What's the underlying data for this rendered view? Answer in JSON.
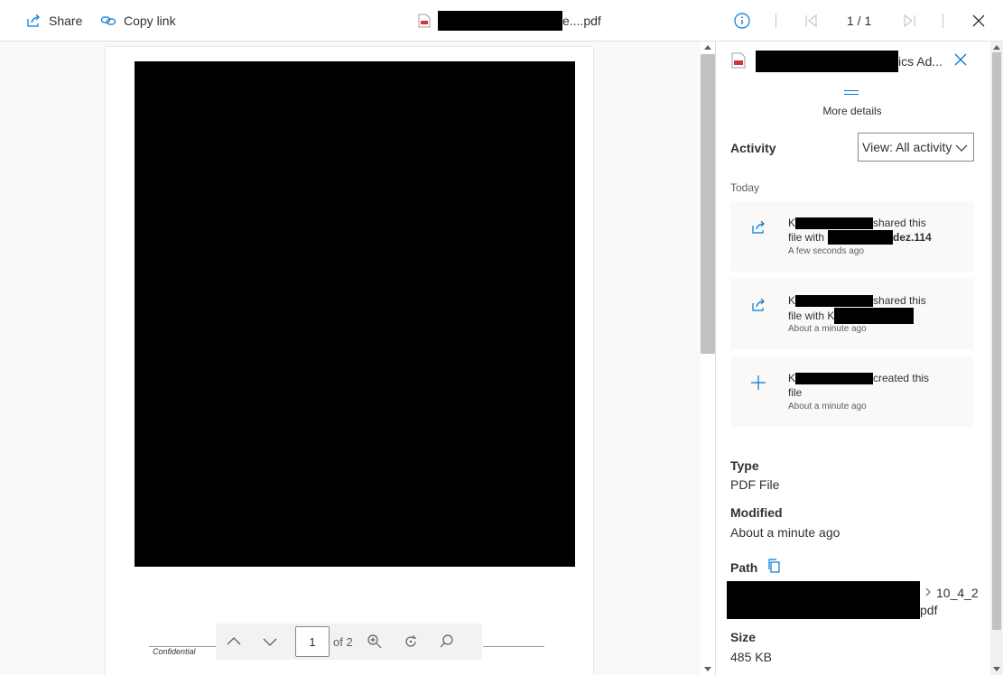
{
  "topbar": {
    "share_label": "Share",
    "copy_link_label": "Copy link",
    "file_title_suffix": "e....pdf",
    "page_indicator": "1 / 1"
  },
  "document": {
    "footer_text": "Confidential",
    "current_page": "1",
    "of_pages": "of 2"
  },
  "panel": {
    "title_suffix": "ics Ad...",
    "more_details_label": "More details",
    "activity_heading": "Activity",
    "view_filter": "View: All activity",
    "group_today": "Today",
    "activities": [
      {
        "actor_prefix": "K",
        "action": "shared this",
        "line2_prefix": "file with",
        "line2_suffix": "dez.114",
        "time": "A few seconds ago",
        "icon": "share-icon"
      },
      {
        "actor_prefix": "K",
        "action": "shared this",
        "line2_prefix": "file with K",
        "line2_suffix": "",
        "time": "About a minute ago",
        "icon": "share-icon"
      },
      {
        "actor_prefix": "K",
        "action": "created this",
        "line2_prefix": "file",
        "line2_suffix": "",
        "time": "About a minute ago",
        "icon": "plus-icon"
      }
    ],
    "properties": {
      "type_label": "Type",
      "type_value": "PDF File",
      "modified_label": "Modified",
      "modified_value": "About a minute ago",
      "path_label": "Path",
      "path_tail": "10_4_2",
      "path_ext": "pdf",
      "size_label": "Size",
      "size_value": "485 KB"
    }
  },
  "colors": {
    "accent": "#0078d4",
    "pdf_red": "#d13438",
    "text": "#323130"
  }
}
